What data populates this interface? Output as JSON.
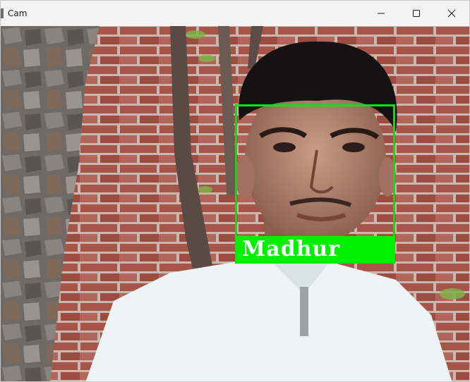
{
  "window": {
    "title": "Cam",
    "controls": {
      "minimize": "minimize-icon",
      "maximize": "maximize-icon",
      "close": "close-icon"
    }
  },
  "camera": {
    "detection": {
      "name": "Madhur",
      "box_color": "#00e600"
    }
  }
}
